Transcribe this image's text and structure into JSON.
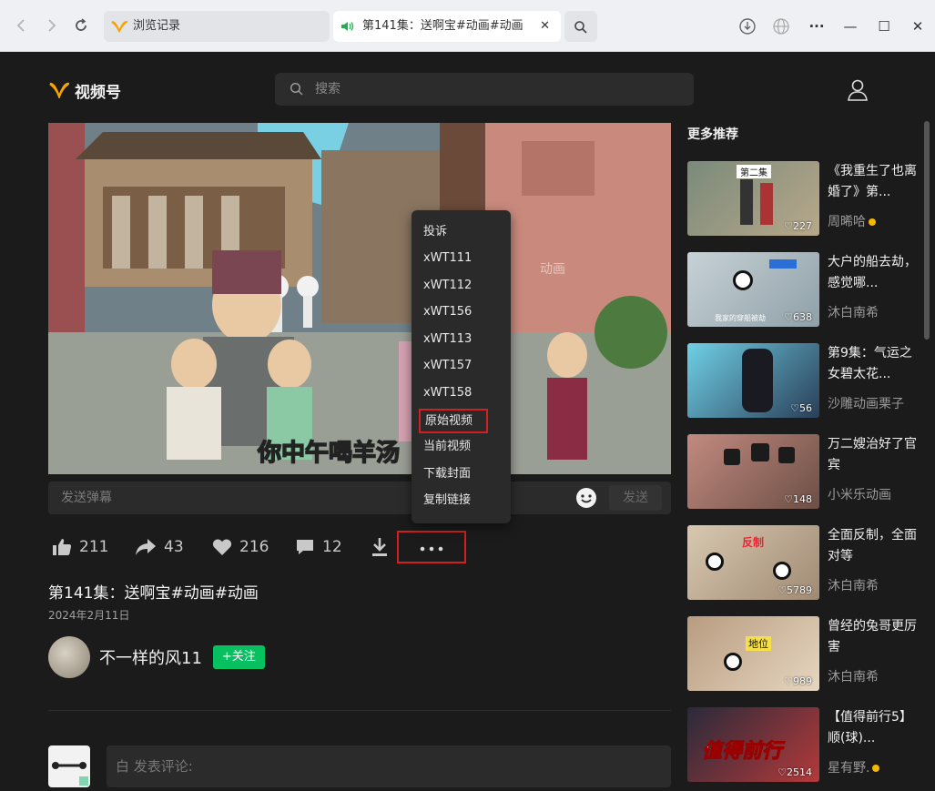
{
  "browser": {
    "back_icon": "chevron-left-icon",
    "forward_icon": "chevron-right-icon",
    "reload_icon": "reload-icon",
    "tab_history_label": "浏览记录",
    "tab_active_label": "第141集：送啊宝#动画#动画",
    "tab_close": "✕",
    "window_minimize": "—",
    "window_maximize": "☐",
    "window_close": "✕"
  },
  "header": {
    "logo_text": "视频号",
    "search_placeholder": "搜索"
  },
  "video": {
    "subtitle": "你中午喝羊汤",
    "watermark": "动画",
    "danmu_placeholder": "发送弹幕",
    "danmu_send": "发送"
  },
  "actions": {
    "likes": "211",
    "shares": "43",
    "favorites": "216",
    "comments": "12"
  },
  "more_menu": {
    "items": [
      "投诉",
      "xWT111",
      "xWT112",
      "xWT156",
      "xWT113",
      "xWT157",
      "xWT158",
      "原始视频",
      "当前视频",
      "下载封面",
      "复制链接"
    ]
  },
  "post": {
    "title": "第141集：送啊宝#动画#动画",
    "date": "2024年2月11日",
    "author": "不一样的风11",
    "follow_label": "+关注",
    "comment_placeholder": "白 发表评论:"
  },
  "sidebar": {
    "title": "更多推荐",
    "items": [
      {
        "title": "《我重生了也离婚了》第...",
        "author": "周晞哈",
        "likes": "♡227",
        "badge": true,
        "thumb_label": "第二集"
      },
      {
        "title": "大户的船去劫，感觉哪...",
        "author": "沐白南希",
        "likes": "♡638",
        "badge": false,
        "thumb_label": "我家的穿船被劫"
      },
      {
        "title": "第9集：气运之女碧太花...",
        "author": "沙雕动画栗子",
        "likes": "♡56",
        "badge": false,
        "thumb_label": ""
      },
      {
        "title": "万二嫂治好了官宾",
        "author": "小米乐动画",
        "likes": "♡148",
        "badge": false,
        "thumb_label": ""
      },
      {
        "title": "全面反制，全面对等",
        "author": "沐白南希",
        "likes": "♡5789",
        "badge": false,
        "thumb_label": "反制"
      },
      {
        "title": "曾经的兔哥更厉害",
        "author": "沐白南希",
        "likes": "♡989",
        "badge": false,
        "thumb_label": "地位"
      },
      {
        "title": "【值得前行5】顺(球)...",
        "author": "星有野.",
        "likes": "♡2514",
        "badge": true,
        "thumb_label": "值得前行"
      }
    ]
  }
}
